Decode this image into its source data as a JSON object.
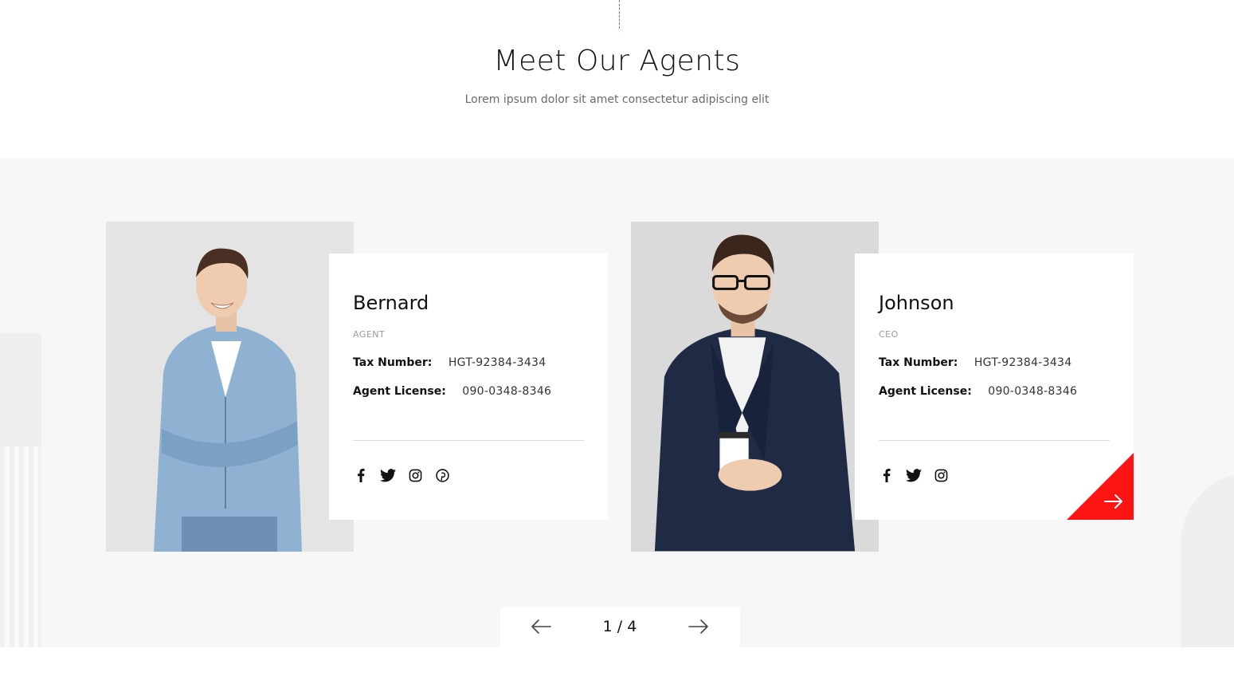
{
  "section": {
    "title": "Meet Our Agents",
    "subtitle": "Lorem ipsum dolor sit amet consectetur adipiscing elit"
  },
  "agents": [
    {
      "name": "Bernard",
      "role": "AGENT",
      "tax_label": "Tax Number:",
      "tax_value": "HGT-92384-3434",
      "license_label": "Agent License:",
      "license_value": "090-0348-8346",
      "socials": [
        "facebook-icon",
        "twitter-icon",
        "instagram-icon",
        "pinterest-icon"
      ],
      "photo": "agent-photo-man-denim-shirt"
    },
    {
      "name": "Johnson",
      "role": "CEO",
      "tax_label": "Tax Number:",
      "tax_value": "HGT-92384-3434",
      "license_label": "Agent License:",
      "license_value": "090-0348-8346",
      "socials": [
        "facebook-icon",
        "twitter-icon",
        "instagram-icon"
      ],
      "photo": "agent-photo-man-blazer-coffee",
      "corner_action": "arrow-right-icon"
    }
  ],
  "pagination": {
    "current": "1",
    "total": "4",
    "label": "1 / 4",
    "prev_icon": "arrow-left-icon",
    "next_icon": "arrow-right-icon"
  },
  "colors": {
    "accent": "#ff1414",
    "band_background": "#f7f7f7",
    "divider_line": "#e0564f"
  }
}
